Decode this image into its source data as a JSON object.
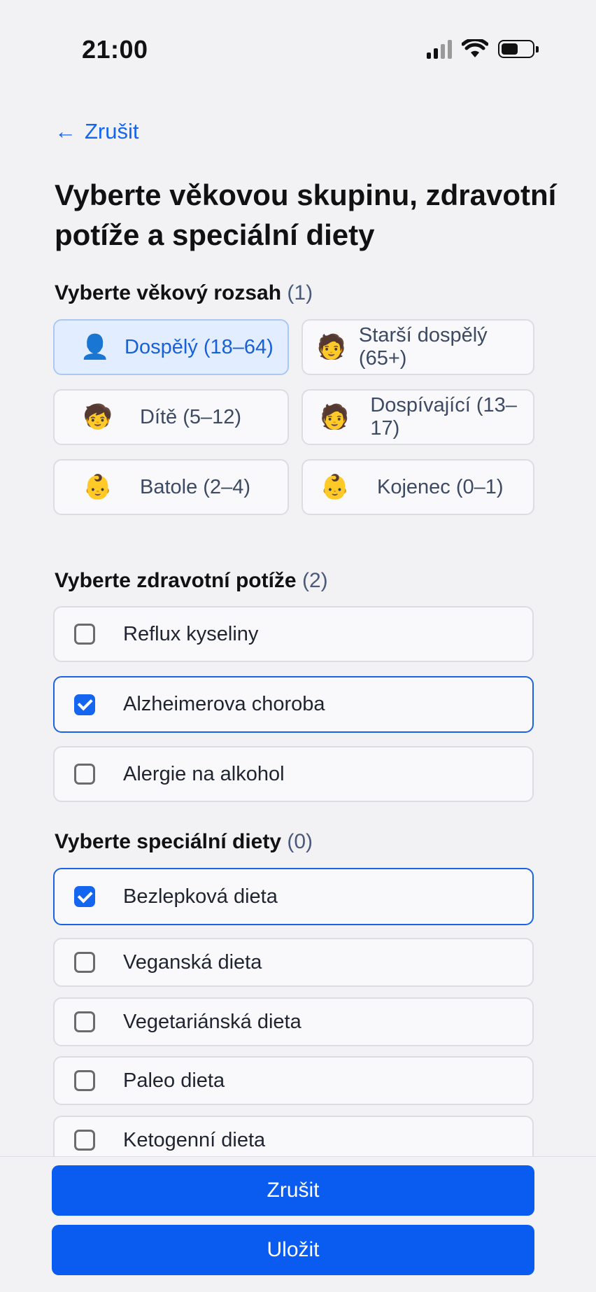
{
  "status_bar": {
    "time": "21:00"
  },
  "header": {
    "back_label": "Zrušit",
    "back_arrow": "←"
  },
  "title": "Vyberte věkovou skupinu, zdravotní potíže a speciální diety",
  "age_section": {
    "title": "Vyberte věkový rozsah",
    "count": "(1)",
    "items": [
      {
        "label": "Dospělý (18–64)",
        "icon": "👤",
        "selected": true
      },
      {
        "label": "Starší dospělý (65+)",
        "icon": "🧑",
        "selected": false
      },
      {
        "label": "Dítě (5–12)",
        "icon": "🧒",
        "selected": false
      },
      {
        "label": "Dospívající (13–17)",
        "icon": "🧑",
        "selected": false
      },
      {
        "label": "Batole (2–4)",
        "icon": "👶",
        "selected": false
      },
      {
        "label": "Kojenec (0–1)",
        "icon": "👶",
        "selected": false
      }
    ]
  },
  "health_section": {
    "title": "Vyberte zdravotní potíže",
    "count": "(2)",
    "items": [
      {
        "label": "Reflux kyseliny",
        "checked": false
      },
      {
        "label": "Alzheimerova choroba",
        "checked": true
      },
      {
        "label": "Alergie na alkohol",
        "checked": false
      }
    ]
  },
  "diet_section": {
    "title": "Vyberte speciální diety",
    "count": "(0)",
    "items": [
      {
        "label": "Bezlepková dieta",
        "checked": true
      },
      {
        "label": "Veganská dieta",
        "checked": false
      },
      {
        "label": "Vegetariánská dieta",
        "checked": false
      },
      {
        "label": "Paleo dieta",
        "checked": false
      },
      {
        "label": "Ketogenní dieta",
        "checked": false
      }
    ]
  },
  "footer": {
    "cancel_label": "Zrušit",
    "save_label": "Uložit"
  },
  "colors": {
    "accent": "#1466f0",
    "selected_bg": "#e2eeff",
    "button": "#0a5cf0"
  }
}
